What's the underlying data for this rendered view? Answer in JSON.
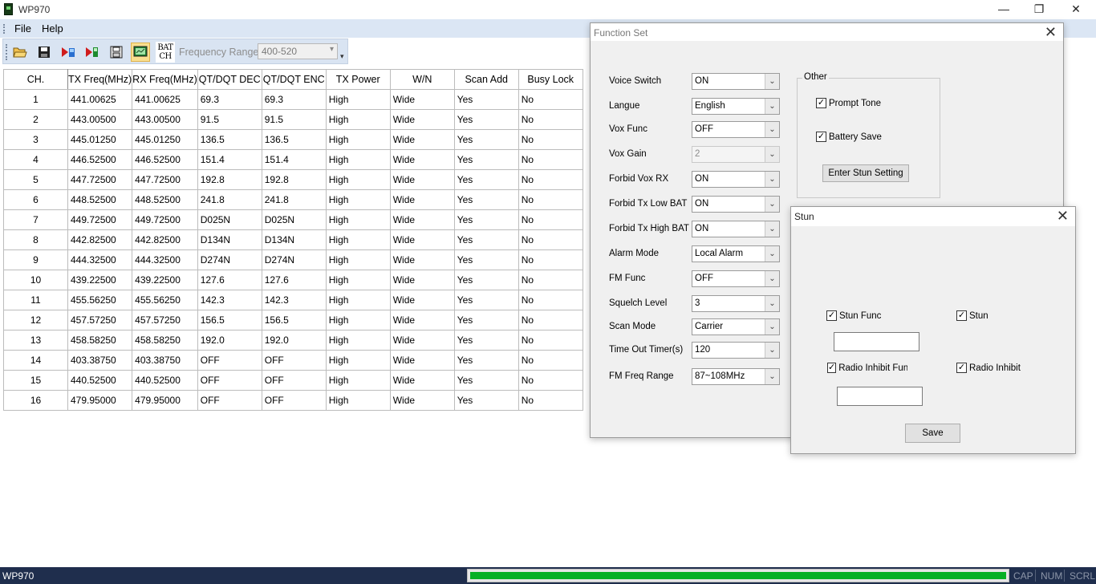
{
  "app": {
    "title": "WP970"
  },
  "window_buttons": {
    "minimize": "—",
    "maximize": "❐",
    "close": "✕"
  },
  "menu": {
    "items": [
      "File",
      "Help"
    ]
  },
  "toolbar": {
    "batch_line1": "BAT",
    "batch_line2": "CH",
    "frequency_range_label": "Frequency Range:",
    "frequency_range_value": "400-520",
    "icons": [
      "open-folder-icon",
      "save-disk-icon",
      "read-radio-icon",
      "write-radio-icon",
      "floppy-icon",
      "monitor-icon"
    ]
  },
  "table": {
    "headers": [
      "CH.",
      "TX Freq(MHz)",
      "RX Freq(MHz)",
      "QT/DQT DEC",
      "QT/DQT ENC",
      "TX Power",
      "W/N",
      "Scan Add",
      "Busy Lock"
    ],
    "rows": [
      [
        "1",
        "441.00625",
        "441.00625",
        "69.3",
        "69.3",
        "High",
        "Wide",
        "Yes",
        "No"
      ],
      [
        "2",
        "443.00500",
        "443.00500",
        "91.5",
        "91.5",
        "High",
        "Wide",
        "Yes",
        "No"
      ],
      [
        "3",
        "445.01250",
        "445.01250",
        "136.5",
        "136.5",
        "High",
        "Wide",
        "Yes",
        "No"
      ],
      [
        "4",
        "446.52500",
        "446.52500",
        "151.4",
        "151.4",
        "High",
        "Wide",
        "Yes",
        "No"
      ],
      [
        "5",
        "447.72500",
        "447.72500",
        "192.8",
        "192.8",
        "High",
        "Wide",
        "Yes",
        "No"
      ],
      [
        "6",
        "448.52500",
        "448.52500",
        "241.8",
        "241.8",
        "High",
        "Wide",
        "Yes",
        "No"
      ],
      [
        "7",
        "449.72500",
        "449.72500",
        "D025N",
        "D025N",
        "High",
        "Wide",
        "Yes",
        "No"
      ],
      [
        "8",
        "442.82500",
        "442.82500",
        "D134N",
        "D134N",
        "High",
        "Wide",
        "Yes",
        "No"
      ],
      [
        "9",
        "444.32500",
        "444.32500",
        "D274N",
        "D274N",
        "High",
        "Wide",
        "Yes",
        "No"
      ],
      [
        "10",
        "439.22500",
        "439.22500",
        "127.6",
        "127.6",
        "High",
        "Wide",
        "Yes",
        "No"
      ],
      [
        "11",
        "455.56250",
        "455.56250",
        "142.3",
        "142.3",
        "High",
        "Wide",
        "Yes",
        "No"
      ],
      [
        "12",
        "457.57250",
        "457.57250",
        "156.5",
        "156.5",
        "High",
        "Wide",
        "Yes",
        "No"
      ],
      [
        "13",
        "458.58250",
        "458.58250",
        "192.0",
        "192.0",
        "High",
        "Wide",
        "Yes",
        "No"
      ],
      [
        "14",
        "403.38750",
        "403.38750",
        "OFF",
        "OFF",
        "High",
        "Wide",
        "Yes",
        "No"
      ],
      [
        "15",
        "440.52500",
        "440.52500",
        "OFF",
        "OFF",
        "High",
        "Wide",
        "Yes",
        "No"
      ],
      [
        "16",
        "479.95000",
        "479.95000",
        "OFF",
        "OFF",
        "High",
        "Wide",
        "Yes",
        "No"
      ]
    ]
  },
  "function_set": {
    "title": "Function Set",
    "close": "✕",
    "fields": [
      {
        "label": "Voice Switch",
        "value": "ON",
        "disabled": false
      },
      {
        "label": "Langue",
        "value": "English",
        "disabled": false
      },
      {
        "label": "Vox Func",
        "value": "OFF",
        "disabled": false
      },
      {
        "label": "Vox Gain",
        "value": "2",
        "disabled": true
      },
      {
        "label": "Forbid Vox RX",
        "value": "ON",
        "disabled": false
      },
      {
        "label": "Forbid Tx Low BAT",
        "value": "ON",
        "disabled": false
      },
      {
        "label": "Forbid Tx High BAT",
        "value": "ON",
        "disabled": false
      },
      {
        "label": "Alarm Mode",
        "value": "Local Alarm",
        "disabled": false
      },
      {
        "label": "FM Func",
        "value": "OFF",
        "disabled": false
      },
      {
        "label": "Squelch Level",
        "value": "3",
        "disabled": false
      },
      {
        "label": "Scan Mode",
        "value": "Carrier",
        "disabled": false
      },
      {
        "label": "Time Out Timer(s)",
        "value": "120",
        "disabled": false
      },
      {
        "label": "FM Freq Range",
        "value": "87~108MHz",
        "disabled": false
      }
    ],
    "other_group": {
      "title": "Other",
      "prompt_tone": {
        "label": "Prompt Tone",
        "checked": true
      },
      "battery_save": {
        "label": "Battery Save",
        "checked": true
      },
      "enter_stun_button": "Enter Stun Setting"
    }
  },
  "stun": {
    "title": "Stun",
    "close": "✕",
    "stun_func": {
      "label": "Stun Func",
      "checked": true
    },
    "stun": {
      "label": "Stun",
      "checked": true
    },
    "radio_inhibit_func": {
      "label": "Radio Inhibit Func",
      "checked": true
    },
    "radio_inhibit": {
      "label": "Radio Inhibit",
      "checked": true
    },
    "stun_code_value": "",
    "inhibit_code_value": "",
    "save_button": "Save"
  },
  "statusbar": {
    "text": "WP970",
    "progress": 1.0,
    "indicators": [
      "CAP",
      "NUM",
      "SCRL"
    ]
  },
  "colors": {
    "titlebar_bg": "#ffffff",
    "menubar_bg": "#dbe6f4",
    "statusbar_bg": "#1f2e4d",
    "progress_fill": "#06b025",
    "dialog_bg": "#f0f0f0"
  }
}
